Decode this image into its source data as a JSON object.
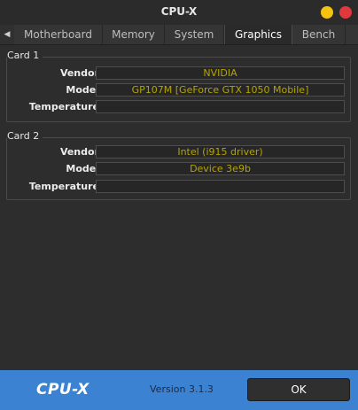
{
  "window": {
    "title": "CPU-X"
  },
  "tabs": [
    {
      "label": "Motherboard"
    },
    {
      "label": "Memory"
    },
    {
      "label": "System"
    },
    {
      "label": "Graphics",
      "active": true
    },
    {
      "label": "Bench"
    }
  ],
  "cards": [
    {
      "title": "Card 1",
      "fields": [
        {
          "label": "Vendor",
          "value": "NVIDIA"
        },
        {
          "label": "Model",
          "value": "GP107M [GeForce GTX 1050 Mobile]"
        },
        {
          "label": "Temperature",
          "value": ""
        }
      ]
    },
    {
      "title": "Card 2",
      "fields": [
        {
          "label": "Vendor",
          "value": "Intel (i915 driver)"
        },
        {
          "label": "Model",
          "value": "Device 3e9b"
        },
        {
          "label": "Temperature",
          "value": ""
        }
      ]
    }
  ],
  "footer": {
    "brand": "CPU-X",
    "version": "Version 3.1.3",
    "ok_label": "OK"
  },
  "colors": {
    "value_text": "#b5a400",
    "footer_bg": "#3b82d3",
    "close_button": "#e0383e",
    "minimize_button": "#f5c211"
  },
  "icons": {
    "tab_scroll_left": "chevron-left-icon",
    "window_minimize": "minimize-icon",
    "window_close": "close-icon"
  }
}
